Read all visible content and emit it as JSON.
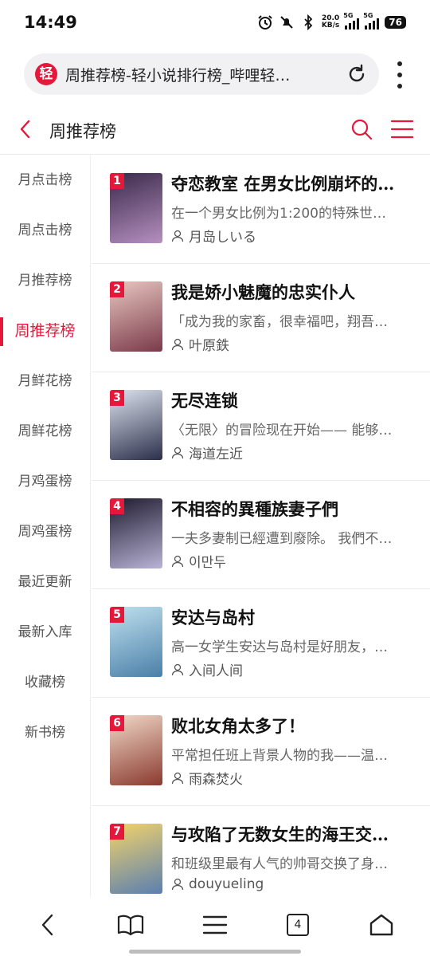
{
  "status": {
    "time": "14:49",
    "net_speed": "20.0",
    "net_unit": "KB/s",
    "sig1": "5G",
    "sig2": "5G",
    "battery": "76"
  },
  "browser": {
    "logo_char": "轻",
    "url_title": "周推荐榜-轻小说排行榜_哔哩轻…",
    "tab_count": "4"
  },
  "header": {
    "title": "周推荐榜"
  },
  "sidebar": {
    "items": [
      {
        "label": "月点击榜"
      },
      {
        "label": "周点击榜"
      },
      {
        "label": "月推荐榜"
      },
      {
        "label": "周推荐榜",
        "active": true
      },
      {
        "label": "月鲜花榜"
      },
      {
        "label": "周鲜花榜"
      },
      {
        "label": "月鸡蛋榜"
      },
      {
        "label": "周鸡蛋榜"
      },
      {
        "label": "最近更新"
      },
      {
        "label": "最新入库"
      },
      {
        "label": "收藏榜"
      },
      {
        "label": "新书榜"
      }
    ]
  },
  "books": [
    {
      "rank": "1",
      "title": "夺恋教室 在男女比例崩坏的…",
      "desc": "在一个男女比例为1:200的特殊世…",
      "author": "月岛しいる",
      "c1": "#3a2a4a",
      "c2": "#b58fc0"
    },
    {
      "rank": "2",
      "title": "我是娇小魅魔的忠实仆人",
      "desc": "「成为我的家畜，很幸福吧，翔吾…",
      "author": "叶原鉄",
      "c1": "#e8c7c0",
      "c2": "#7a3a4a"
    },
    {
      "rank": "3",
      "title": "无尽连锁",
      "desc": "〈无限〉的冒险现在开始—— 能够…",
      "author": "海道左近",
      "c1": "#dde3ef",
      "c2": "#2b2f4a"
    },
    {
      "rank": "4",
      "title": "不相容的異種族妻子們",
      "desc": "一夫多妻制已經遭到廢除。 我們不…",
      "author": "이만두",
      "c1": "#1e1a2e",
      "c2": "#b9b3d6"
    },
    {
      "rank": "5",
      "title": "安达与岛村",
      "desc": "高一女学生安达与岛村是好朋友，…",
      "author": "入间人间",
      "c1": "#bfe0ee",
      "c2": "#4a7fa8"
    },
    {
      "rank": "6",
      "title": "败北女角太多了！",
      "desc": "平常担任班上背景人物的我——温…",
      "author": "雨森焚火",
      "c1": "#f1d9c9",
      "c2": "#8a3a2e"
    },
    {
      "rank": "7",
      "title": "与攻陷了无数女生的海王交…",
      "desc": "和班级里最有人气的帅哥交换了身…",
      "author": "douyueling",
      "c1": "#f3d36a",
      "c2": "#5a7fb0"
    }
  ],
  "colors": {
    "accent": "#e5173b"
  },
  "icons": [
    "back-icon",
    "search-icon",
    "list-menu-icon",
    "reload-icon",
    "more-icon",
    "user-icon",
    "book-icon",
    "home-icon"
  ]
}
